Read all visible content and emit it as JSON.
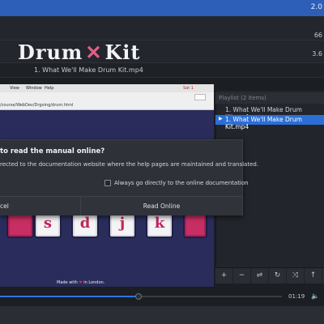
{
  "top_bar": {
    "right_value": "2.0"
  },
  "info_rows": [
    {
      "value": "66"
    },
    {
      "value": "3.6"
    }
  ],
  "media_title": "1. What We'll Make Drum Kit.mp4",
  "video": {
    "menubar": {
      "items": [
        "View",
        "Window",
        "Help"
      ],
      "right_text": "Sat 1"
    },
    "url": "/course/WebDev/Drgoing/drum.html",
    "heading_left": "Drum",
    "heading_mid": "✕",
    "heading_right": "Kit",
    "pads": [
      "s",
      "d",
      "j",
      "k"
    ],
    "credit_prefix": "Made with",
    "credit_heart": "❤",
    "credit_suffix": "in London."
  },
  "playlist": {
    "header": "Playlist (2 items)",
    "items": [
      {
        "label": "1. What We'll Make Drum Kit.mp4"
      },
      {
        "label": "1. What We'll Make Drum Kit.mp4",
        "playing": true
      }
    ],
    "tools": [
      "+",
      "−",
      "⇌",
      "↻",
      "⤨",
      "↑",
      "↓"
    ]
  },
  "dialog": {
    "title": "to read the manual online?",
    "message": "rected to the documentation website where the help pages are maintained and translated.",
    "checkbox_label": "Always go directly to the online documentation",
    "cancel_label": "cel",
    "read_online_label": "Read Online"
  },
  "playback": {
    "time": "01:19",
    "progress": 0.49,
    "volume_icon": "🔈"
  }
}
